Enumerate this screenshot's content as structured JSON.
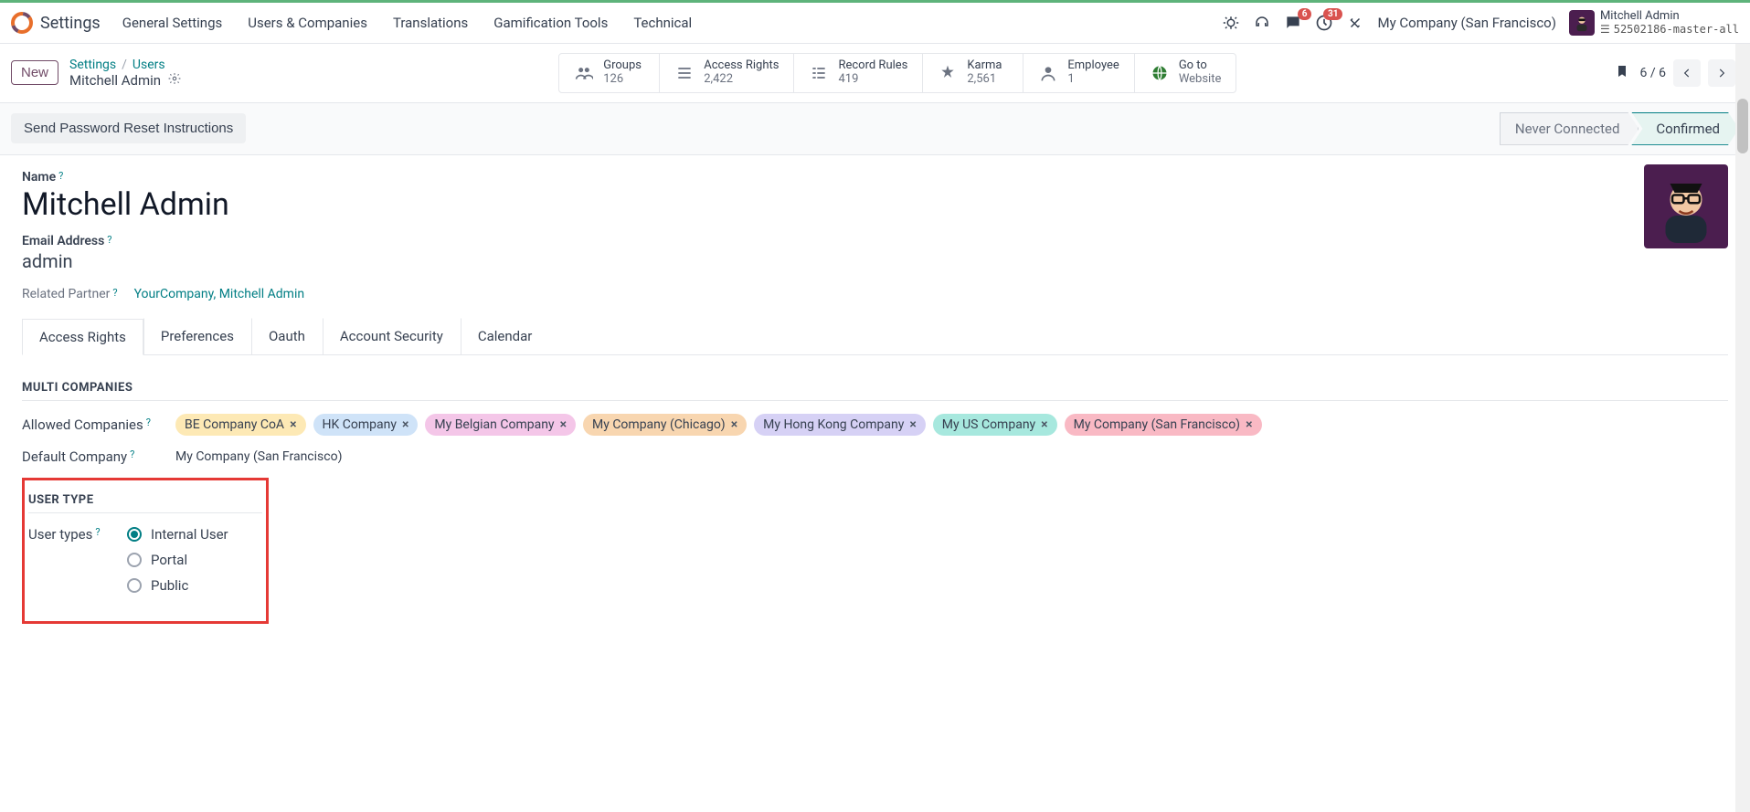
{
  "app": {
    "title": "Settings",
    "menu": [
      "General Settings",
      "Users & Companies",
      "Translations",
      "Gamification Tools",
      "Technical"
    ]
  },
  "systray": {
    "messages_badge": "6",
    "activities_badge": "31",
    "company": "My Company (San Francisco)",
    "user": {
      "name": "Mitchell Admin",
      "database": "52502186-master-all"
    }
  },
  "controlbar": {
    "new_label": "New",
    "breadcrumb": {
      "root": "Settings",
      "sep": "/",
      "parent": "Users",
      "record": "Mitchell Admin"
    },
    "stats": {
      "groups": {
        "label": "Groups",
        "value": "126"
      },
      "access_rights": {
        "label": "Access Rights",
        "value": "2,422"
      },
      "record_rules": {
        "label": "Record Rules",
        "value": "419"
      },
      "karma": {
        "label": "Karma",
        "value": "2,561"
      },
      "employee": {
        "label": "Employee",
        "value": "1"
      },
      "go_to_website": {
        "label": "Go to",
        "value": "Website"
      }
    },
    "pager": "6 / 6"
  },
  "status": {
    "reset_button": "Send Password Reset Instructions",
    "steps": [
      "Never Connected",
      "Confirmed"
    ],
    "active_index": 1
  },
  "form": {
    "name_label": "Name",
    "name_value": "Mitchell Admin",
    "email_label": "Email Address",
    "email_value": "admin",
    "related_label": "Related Partner",
    "related_value": "YourCompany, Mitchell Admin",
    "tabs": [
      "Access Rights",
      "Preferences",
      "Oauth",
      "Account Security",
      "Calendar"
    ],
    "active_tab": 0,
    "multi_companies_title": "MULTI COMPANIES",
    "allowed_label": "Allowed Companies",
    "allowed_tags": [
      "BE Company CoA",
      "HK Company",
      "My Belgian Company",
      "My Company (Chicago)",
      "My Hong Kong Company",
      "My US Company",
      "My Company (San Francisco)"
    ],
    "default_company_label": "Default Company",
    "default_company_value": "My Company (San Francisco)",
    "user_type_title": "USER TYPE",
    "user_types_label": "User types",
    "user_type_options": [
      "Internal User",
      "Portal",
      "Public"
    ],
    "user_type_selected": 0
  }
}
